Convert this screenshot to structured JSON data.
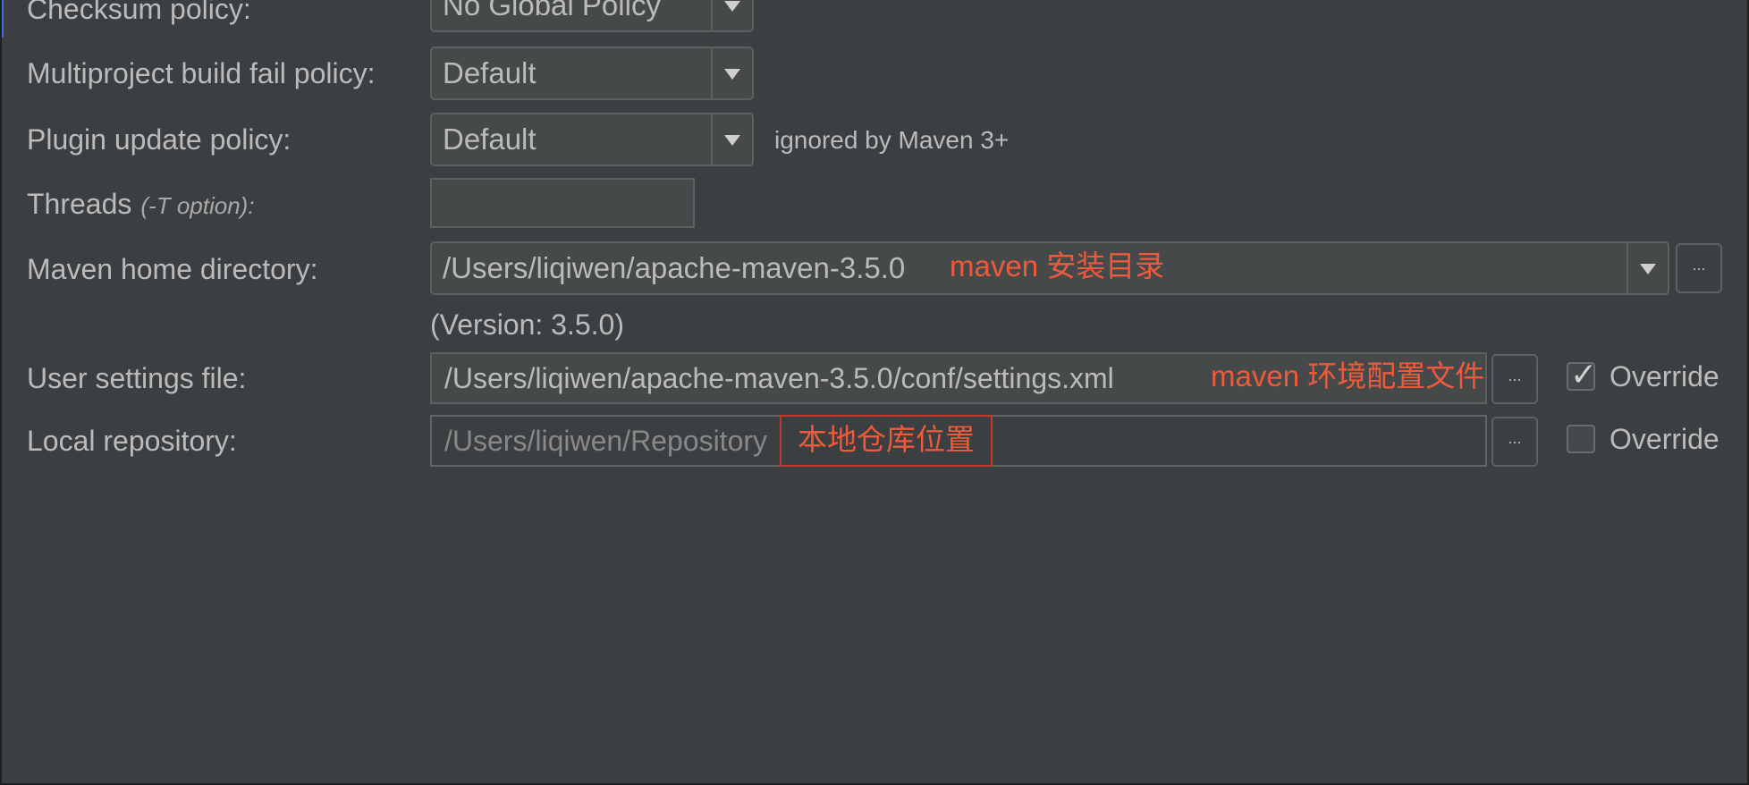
{
  "rows": {
    "checksum": {
      "label": "Checksum policy:",
      "value": "No Global Policy"
    },
    "multiproject": {
      "label": "Multiproject build fail policy:",
      "value": "Default"
    },
    "plugin": {
      "label": "Plugin update policy:",
      "value": "Default",
      "note": "ignored by Maven 3+"
    },
    "threads": {
      "label": "Threads",
      "hint": "(-T option):",
      "value": ""
    },
    "maven_home": {
      "label": "Maven home directory:",
      "value": "/Users/liqiwen/apache-maven-3.5.0",
      "annotation": "maven 安装目录",
      "version": "(Version: 3.5.0)",
      "browse_label": "..."
    },
    "user_settings": {
      "label": "User settings file:",
      "value": "/Users/liqiwen/apache-maven-3.5.0/conf/settings.xml",
      "annotation": "maven 环境配置文件",
      "browse_label": "...",
      "override_label": "Override",
      "override_checked": true
    },
    "local_repo": {
      "label": "Local repository:",
      "value": "/Users/liqiwen/Repository",
      "annotation": "本地仓库位置",
      "browse_label": "...",
      "override_label": "Override",
      "override_checked": false
    }
  },
  "colors": {
    "background": "#3c3f41",
    "text": "#bbbbbb",
    "annotation": "#ee5a3a",
    "accent": "#3d6dd1"
  }
}
